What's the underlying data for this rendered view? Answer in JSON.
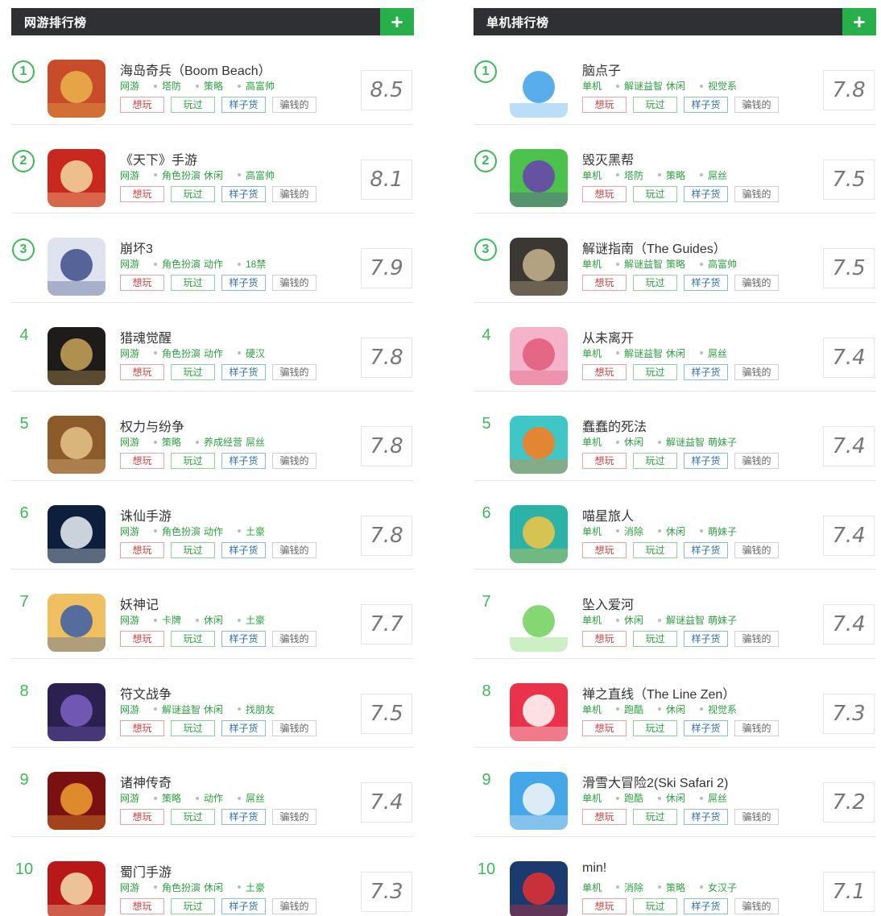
{
  "actions": {
    "want": "想玩",
    "play": "玩过",
    "grow": "样子货",
    "cheat": "骗钱的"
  },
  "left": {
    "title": "网游排行榜",
    "plus": "+",
    "games": [
      {
        "rank": "1",
        "circle": true,
        "name": "海岛奇兵（Boom Beach）",
        "cats": [
          "网游",
          "塔防",
          "策略",
          "高富帅"
        ],
        "score": "8.5",
        "icon": "boom-beach",
        "colors": [
          "#c84b2a",
          "#e9b44c"
        ]
      },
      {
        "rank": "2",
        "circle": true,
        "name": "《天下》手游",
        "cats": [
          "网游",
          "角色扮演",
          "休闲",
          "高富帅"
        ],
        "score": "8.1",
        "icon": "tianxia",
        "colors": [
          "#c9281e",
          "#f5d9a0"
        ]
      },
      {
        "rank": "3",
        "circle": true,
        "name": "崩坏3",
        "cats": [
          "网游",
          "角色扮演",
          "动作",
          "18禁"
        ],
        "score": "7.9",
        "icon": "honkai",
        "colors": [
          "#dfe3ef",
          "#3e4c8a"
        ]
      },
      {
        "rank": "4",
        "circle": false,
        "name": "猎魂觉醒",
        "cats": [
          "网游",
          "角色扮演",
          "动作",
          "硬汉"
        ],
        "score": "7.8",
        "icon": "liehun",
        "colors": [
          "#1e1c1a",
          "#c9a45c"
        ]
      },
      {
        "rank": "5",
        "circle": false,
        "name": "权力与纷争",
        "cats": [
          "网游",
          "策略",
          "养成经营",
          "屌丝"
        ],
        "score": "7.8",
        "icon": "quanli",
        "colors": [
          "#8c5a2b",
          "#e6c48a"
        ]
      },
      {
        "rank": "6",
        "circle": false,
        "name": "诛仙手游",
        "cats": [
          "网游",
          "角色扮演",
          "动作",
          "土豪"
        ],
        "score": "7.8",
        "icon": "zhuxian",
        "colors": [
          "#0d1f3c",
          "#eef2f8"
        ]
      },
      {
        "rank": "7",
        "circle": false,
        "name": "妖神记",
        "cats": [
          "网游",
          "卡牌",
          "休闲",
          "土豪"
        ],
        "score": "7.7",
        "icon": "yaoshen",
        "colors": [
          "#f0c060",
          "#3a5da8"
        ]
      },
      {
        "rank": "8",
        "circle": false,
        "name": "符文战争",
        "cats": [
          "网游",
          "解谜益智",
          "休闲",
          "找朋友"
        ],
        "score": "7.5",
        "icon": "fuwen",
        "colors": [
          "#2b2050",
          "#7b62c4"
        ]
      },
      {
        "rank": "9",
        "circle": false,
        "name": "诸神传奇",
        "cats": [
          "网游",
          "策略",
          "动作",
          "屌丝"
        ],
        "score": "7.4",
        "icon": "zhushen",
        "colors": [
          "#7a1010",
          "#f0a030"
        ]
      },
      {
        "rank": "10",
        "circle": false,
        "name": "蜀门手游",
        "cats": [
          "网游",
          "角色扮演",
          "休闲",
          "土豪"
        ],
        "score": "7.3",
        "icon": "shumen",
        "colors": [
          "#b81818",
          "#f5e0b0"
        ]
      }
    ]
  },
  "right": {
    "title": "单机排行榜",
    "plus": "+",
    "games": [
      {
        "rank": "1",
        "circle": true,
        "name": "脑点子",
        "cats": [
          "单机",
          "解谜益智",
          "休闲",
          "视觉系"
        ],
        "score": "7.8",
        "icon": "naodianzi",
        "colors": [
          "#ffffff",
          "#3aa0e8"
        ]
      },
      {
        "rank": "2",
        "circle": true,
        "name": "毁灭黑帮",
        "cats": [
          "单机",
          "塔防",
          "策略",
          "屌丝"
        ],
        "score": "7.5",
        "icon": "gang",
        "colors": [
          "#4bc24b",
          "#6a3fb0"
        ]
      },
      {
        "rank": "3",
        "circle": true,
        "name": "解谜指南（The Guides）",
        "cats": [
          "单机",
          "解谜益智",
          "策略",
          "高富帅"
        ],
        "score": "7.5",
        "icon": "guides",
        "colors": [
          "#3b3733",
          "#c8b590"
        ]
      },
      {
        "rank": "4",
        "circle": false,
        "name": "从未离开",
        "cats": [
          "单机",
          "解谜益智",
          "休闲",
          "屌丝"
        ],
        "score": "7.4",
        "icon": "congwei",
        "colors": [
          "#f4b3c8",
          "#e05a7a"
        ]
      },
      {
        "rank": "5",
        "circle": false,
        "name": "蠢蠢的死法",
        "cats": [
          "单机",
          "休闲",
          "解谜益智",
          "萌妹子"
        ],
        "score": "7.4",
        "icon": "chunchun",
        "colors": [
          "#3fc6c6",
          "#ff7a1a"
        ]
      },
      {
        "rank": "6",
        "circle": false,
        "name": "喵星旅人",
        "cats": [
          "单机",
          "消除",
          "休闲",
          "萌妹子"
        ],
        "score": "7.4",
        "icon": "miaoxing",
        "colors": [
          "#2bb3a8",
          "#f4c542"
        ]
      },
      {
        "rank": "7",
        "circle": false,
        "name": "坠入爱河",
        "cats": [
          "单机",
          "休闲",
          "解谜益智",
          "萌妹子"
        ],
        "score": "7.4",
        "icon": "zhuiru",
        "colors": [
          "#ffffff",
          "#6fd05a"
        ]
      },
      {
        "rank": "8",
        "circle": false,
        "name": "禅之直线（The Line Zen）",
        "cats": [
          "单机",
          "跑酷",
          "休闲",
          "视觉系"
        ],
        "score": "7.3",
        "icon": "linezen",
        "colors": [
          "#e8334a",
          "#ffffff"
        ]
      },
      {
        "rank": "9",
        "circle": false,
        "name": "滑雪大冒险2(Ski Safari 2)",
        "cats": [
          "单机",
          "跑酷",
          "休闲",
          "屌丝"
        ],
        "score": "7.2",
        "icon": "skisafari",
        "colors": [
          "#45a7e8",
          "#f7f7f7"
        ]
      },
      {
        "rank": "10",
        "circle": false,
        "name": "min!",
        "cats": [
          "单机",
          "消除",
          "策略",
          "女汉子"
        ],
        "score": "7.1",
        "icon": "min",
        "colors": [
          "#1a3a70",
          "#e83030"
        ]
      }
    ]
  }
}
